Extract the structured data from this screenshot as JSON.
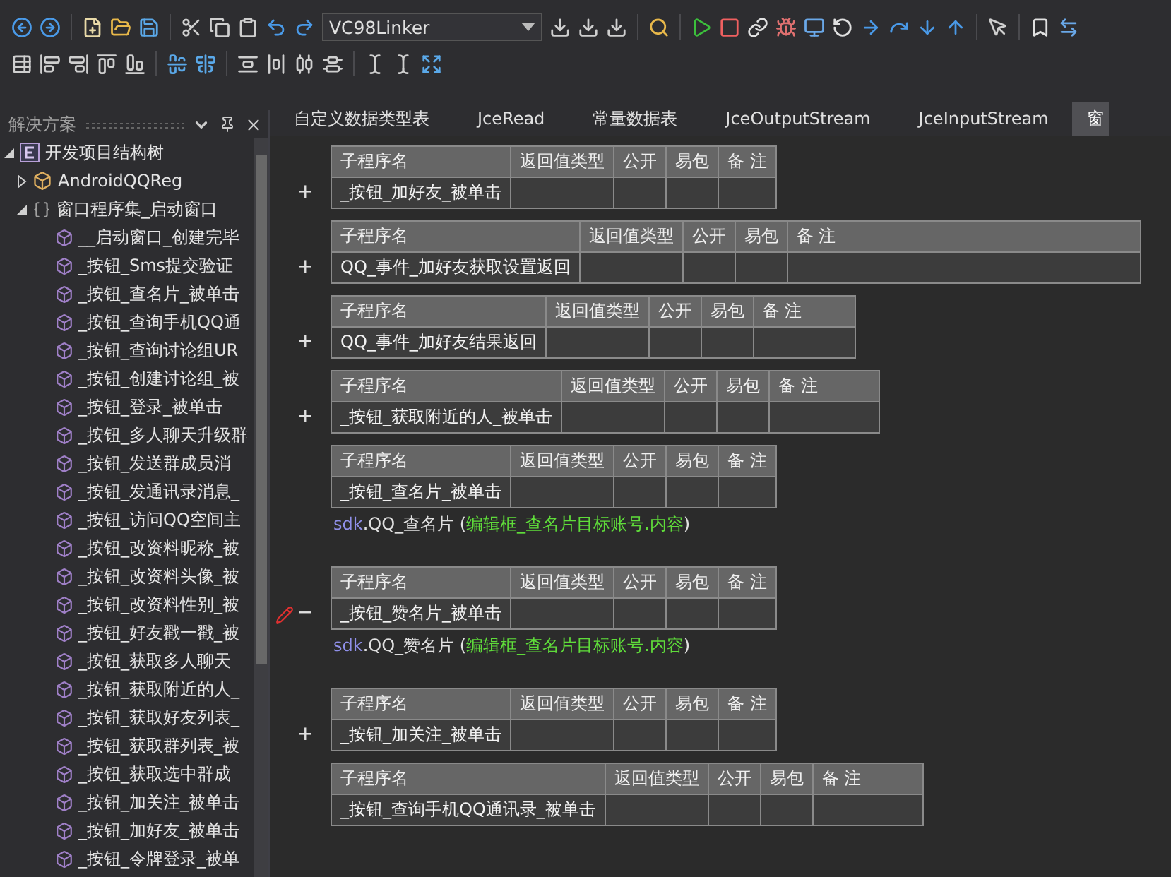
{
  "toolbar": {
    "linker": "VC98Linker"
  },
  "solution_panel": {
    "title": "解决方案"
  },
  "tree": [
    {
      "label": "开发项目结构树",
      "kind": "project",
      "expanded": true,
      "children": [
        {
          "label": "AndroidQQReg",
          "kind": "module",
          "expanded": false
        },
        {
          "label": "窗口程序集_启动窗口",
          "kind": "class",
          "expanded": true,
          "children": [
            {
              "label": "__启动窗口_创建完毕",
              "kind": "method"
            },
            {
              "label": "_按钮_Sms提交验证",
              "kind": "method"
            },
            {
              "label": "_按钮_查名片_被单击",
              "kind": "method"
            },
            {
              "label": "_按钮_查询手机QQ通",
              "kind": "method"
            },
            {
              "label": "_按钮_查询讨论组UR",
              "kind": "method"
            },
            {
              "label": "_按钮_创建讨论组_被",
              "kind": "method"
            },
            {
              "label": "_按钮_登录_被单击",
              "kind": "method"
            },
            {
              "label": "_按钮_多人聊天升级群",
              "kind": "method"
            },
            {
              "label": "_按钮_发送群成员消",
              "kind": "method"
            },
            {
              "label": "_按钮_发通讯录消息_",
              "kind": "method"
            },
            {
              "label": "_按钮_访问QQ空间主",
              "kind": "method"
            },
            {
              "label": "_按钮_改资料昵称_被",
              "kind": "method"
            },
            {
              "label": "_按钮_改资料头像_被",
              "kind": "method"
            },
            {
              "label": "_按钮_改资料性别_被",
              "kind": "method"
            },
            {
              "label": "_按钮_好友戳一戳_被",
              "kind": "method"
            },
            {
              "label": "_按钮_获取多人聊天",
              "kind": "method"
            },
            {
              "label": "_按钮_获取附近的人_",
              "kind": "method"
            },
            {
              "label": "_按钮_获取好友列表_",
              "kind": "method"
            },
            {
              "label": "_按钮_获取群列表_被",
              "kind": "method"
            },
            {
              "label": "_按钮_获取选中群成",
              "kind": "method"
            },
            {
              "label": "_按钮_加关注_被单击",
              "kind": "method"
            },
            {
              "label": "_按钮_加好友_被单击",
              "kind": "method"
            },
            {
              "label": "_按钮_令牌登录_被单",
              "kind": "method"
            }
          ]
        }
      ]
    }
  ],
  "tabs": [
    {
      "label": "自定义数据类型表",
      "selected": false
    },
    {
      "label": "JceRead",
      "selected": false
    },
    {
      "label": "常量数据表",
      "selected": false
    },
    {
      "label": "JceOutputStream",
      "selected": false
    },
    {
      "label": "JceInputStream",
      "selected": false
    },
    {
      "label": "窗",
      "selected": true
    }
  ],
  "procedures": [
    {
      "marker": "+",
      "columns": [
        "子程序名",
        "返回值类型",
        "公开",
        "易包",
        "备 注"
      ],
      "name": "_按钮_加好友_被单击"
    },
    {
      "marker": "+",
      "columns": [
        "子程序名",
        "返回值类型",
        "公开",
        "易包",
        "备 注"
      ],
      "name": "QQ_事件_加好友获取设置返回"
    },
    {
      "marker": "+",
      "columns": [
        "子程序名",
        "返回值类型",
        "公开",
        "易包",
        "备 注"
      ],
      "name": "QQ_事件_加好友结果返回"
    },
    {
      "marker": "+",
      "columns": [
        "子程序名",
        "返回值类型",
        "公开",
        "易包",
        "备 注"
      ],
      "name": "_按钮_获取附近的人_被单击"
    },
    {
      "columns": [
        "子程序名",
        "返回值类型",
        "公开",
        "易包",
        "备 注"
      ],
      "name": "_按钮_查名片_被单击",
      "code": [
        [
          {
            "kind": "object",
            "text": "sdk"
          },
          {
            "kind": "plain",
            "text": ".QQ_查名片 ("
          },
          {
            "kind": "argument",
            "text": "编辑框_查名片目标账号.内容"
          },
          {
            "kind": "plain",
            "text": ")"
          }
        ]
      ]
    },
    {
      "marker": "−",
      "flagged": true,
      "columns": [
        "子程序名",
        "返回值类型",
        "公开",
        "易包",
        "备 注"
      ],
      "name": "_按钮_赞名片_被单击",
      "code": [
        [
          {
            "kind": "object",
            "text": "sdk"
          },
          {
            "kind": "plain",
            "text": ".QQ_赞名片 ("
          },
          {
            "kind": "argument",
            "text": "编辑框_查名片目标账号.内容"
          },
          {
            "kind": "plain",
            "text": ")"
          }
        ]
      ]
    },
    {
      "marker": "+",
      "columns": [
        "子程序名",
        "返回值类型",
        "公开",
        "易包",
        "备 注"
      ],
      "name": "_按钮_加关注_被单击"
    },
    {
      "columns": [
        "子程序名",
        "返回值类型",
        "公开",
        "易包",
        "备 注"
      ],
      "name": "_按钮_查询手机QQ通讯录_被单击"
    }
  ]
}
